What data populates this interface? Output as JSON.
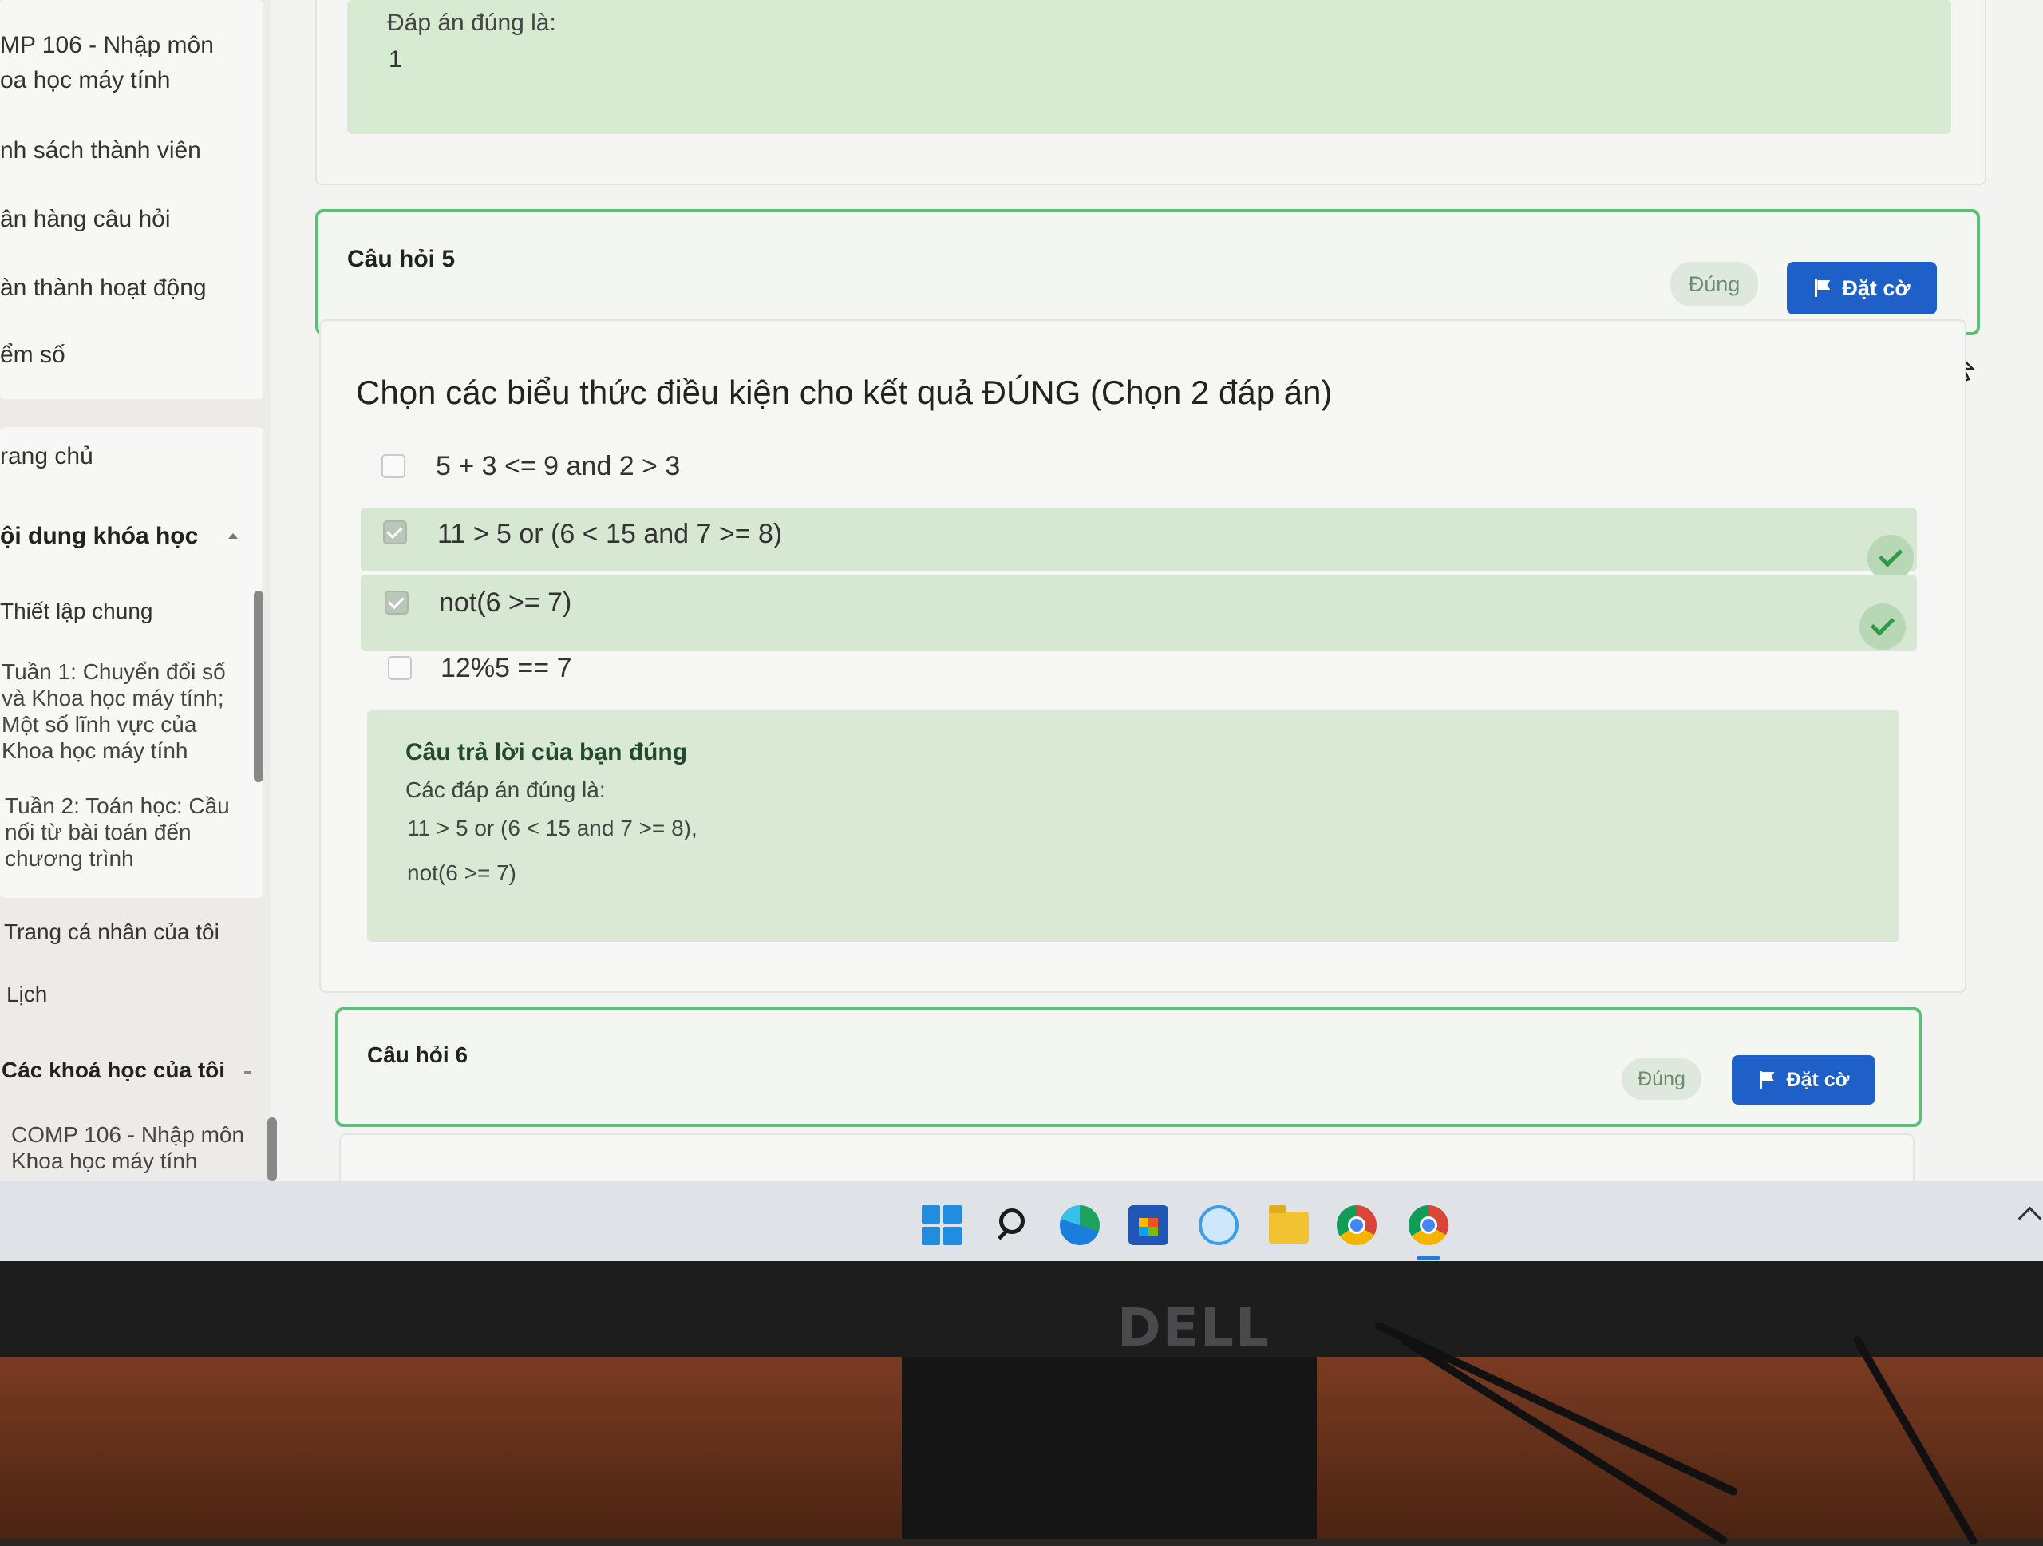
{
  "sidebar": {
    "course_title_line1": "MP 106 - Nhập môn",
    "course_title_line2": "oa học máy tính",
    "items": [
      "nh sách thành viên",
      "ân hàng câu hỏi",
      "àn thành hoạt động",
      "ểm số"
    ],
    "home": "rang chủ",
    "course_content": "ội dung khóa học",
    "general_setup": "Thiết lập chung",
    "week1": [
      "Tuần 1: Chuyển đổi số",
      "và Khoa học máy tính;",
      "Một số lĩnh vực của",
      "Khoa học máy tính"
    ],
    "week2": [
      "Tuần 2: Toán học: Cầu",
      "nối từ bài toán đến",
      "chương trình"
    ],
    "my_profile": "Trang cá nhân của tôi",
    "calendar": "Lịch",
    "my_courses": "Các khoá học của tôi",
    "my_course_item": [
      "COMP 106 - Nhập môn",
      "Khoa học máy tính"
    ]
  },
  "prev_answer": {
    "label": "Đáp án đúng là:",
    "value": "1"
  },
  "question5": {
    "title": "Câu hỏi 5",
    "status": "Đúng",
    "flag_label": "Đặt cờ",
    "prompt": "Chọn các biểu thức điều kiện cho kết quả ĐÚNG (Chọn 2 đáp án)",
    "options": [
      {
        "text": "5 + 3 <= 9 and 2 > 3",
        "checked": false,
        "correct": false
      },
      {
        "text": "11 > 5 or (6 < 15 and 7 >= 8)",
        "checked": true,
        "correct": true
      },
      {
        "text": "not(6 >= 7)",
        "checked": true,
        "correct": true
      },
      {
        "text": "12%5 == 7",
        "checked": false,
        "correct": false
      }
    ],
    "feedback": {
      "title": "Câu trả lời của bạn đúng",
      "answers_label": "Các đáp án đúng là:",
      "answer1": "11 > 5 or (6 < 15 and 7 >= 8),",
      "answer2": "not(6 >= 7)"
    }
  },
  "question6": {
    "title": "Câu hỏi 6",
    "status": "Đúng",
    "flag_label": "Đặt cờ"
  },
  "bezel": {
    "brand": "DELL"
  },
  "taskbar": {
    "icons": [
      "windows-start-icon",
      "search-icon",
      "edge-icon",
      "store-icon",
      "meet-icon",
      "file-explorer-icon",
      "chrome-icon",
      "chrome-profile-icon"
    ]
  },
  "colors": {
    "accent_green": "#5cbf77",
    "flag_button": "#1f5fc8",
    "correct_bg": "#d6e7d2"
  }
}
